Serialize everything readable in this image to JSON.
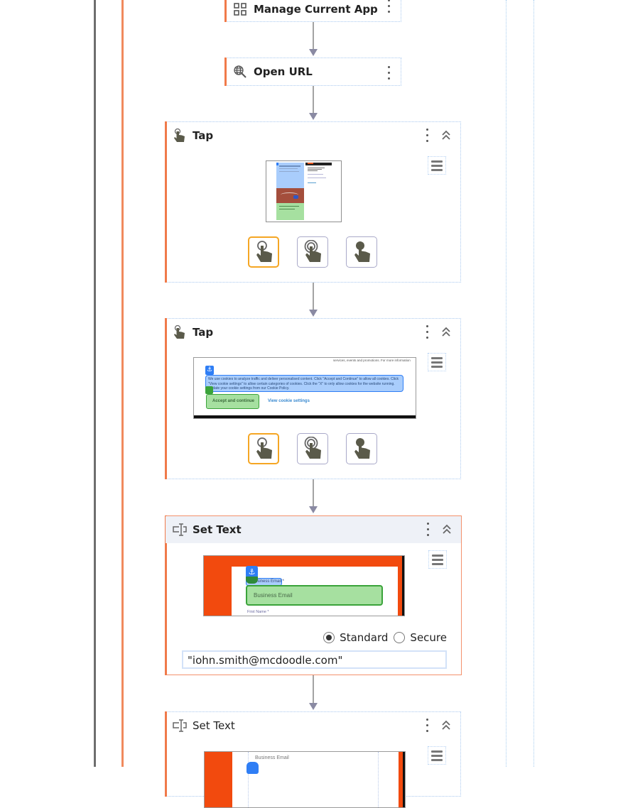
{
  "flow": {
    "steps": [
      {
        "title": "Manage Current App",
        "icon": "grid-icon"
      },
      {
        "title": "Open URL",
        "icon": "globe-search-icon"
      },
      {
        "title": "Tap",
        "icon": "tap-icon",
        "thumbnail": "web-page-screenshot",
        "tap_modes": [
          "tap",
          "double-tap",
          "long-press"
        ],
        "selected_tap_mode": "tap"
      },
      {
        "title": "Tap",
        "icon": "tap-icon",
        "thumbnail": {
          "top_text": "services, events and promotions. For more information",
          "cookie_text": "We use cookies to analyze traffic and deliver personalised content. Click \"Accept and Continue\" to allow all cookies. Click \"View cookie settings\" to allow certain categories of cookies. Click the \"X\" to only allow cookies for the website running. Update your cookie settings from our Cookie Policy.",
          "accept_button": "Accept and continue",
          "view_settings_link": "View cookie settings"
        },
        "tap_modes": [
          "tap",
          "double-tap",
          "long-press"
        ],
        "selected_tap_mode": "tap"
      },
      {
        "title": "Set Text",
        "icon": "text-cursor-icon",
        "thumbnail": {
          "field_label": "Business Email *",
          "field_placeholder": "Business Email",
          "next_label": "First Name *"
        },
        "input_modes": [
          "Standard",
          "Secure"
        ],
        "selected_input_mode": "Standard",
        "value": "\"iohn.smith@mcdoodle.com\""
      },
      {
        "title": "Set Text",
        "icon": "text-cursor-icon",
        "thumbnail": {
          "field_label": "Business Email"
        }
      }
    ]
  },
  "colors": {
    "accent_orange": "#f07a4a",
    "selected_tap_border": "#f5a623",
    "highlight_blue": "#2f7ef5",
    "highlight_green": "#3aa33a",
    "page_orange": "#f24a0e"
  }
}
